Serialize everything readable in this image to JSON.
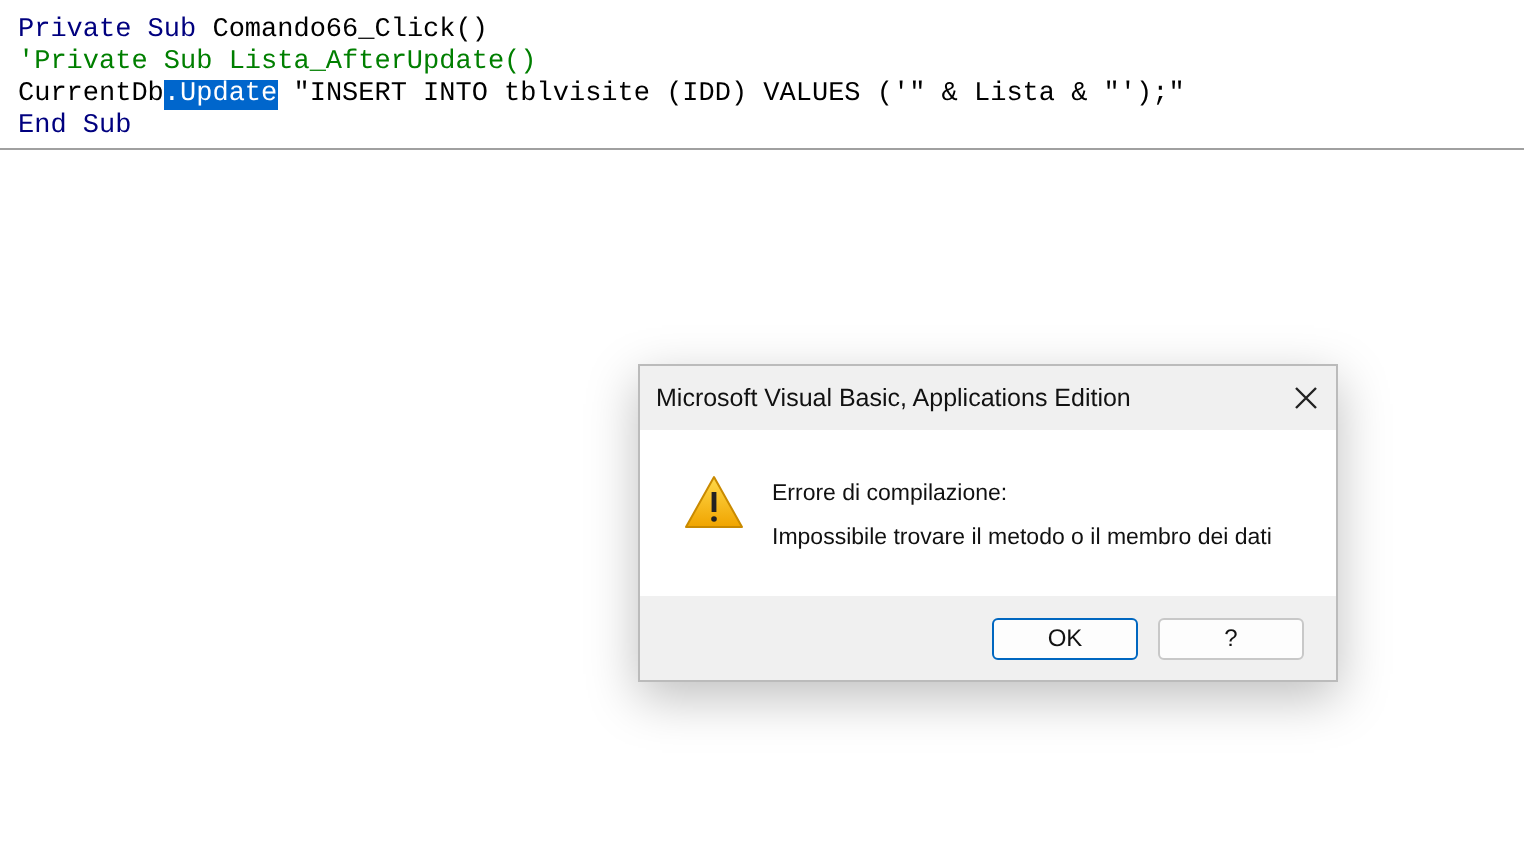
{
  "code": {
    "lines": [
      {
        "tokens": [
          {
            "text": "Private Sub",
            "kind": "keyword"
          },
          {
            "text": " Comando66_Click()",
            "kind": "text"
          }
        ]
      },
      {
        "tokens": [
          {
            "text": "'Private Sub Lista_AfterUpdate()",
            "kind": "comment"
          }
        ]
      },
      {
        "tokens": [
          {
            "text": "CurrentDb",
            "kind": "text"
          },
          {
            "text": ".Update",
            "kind": "selected"
          },
          {
            "text": " \"INSERT INTO tblvisite (IDD) VALUES ('\" & Lista & \"');\"",
            "kind": "text"
          }
        ]
      },
      {
        "tokens": [
          {
            "text": "End Sub",
            "kind": "keyword"
          }
        ]
      }
    ]
  },
  "dialog": {
    "title": "Microsoft Visual Basic, Applications Edition",
    "heading": "Errore di compilazione:",
    "message": "Impossibile trovare il metodo o il membro dei dati",
    "buttons": [
      {
        "label": "OK",
        "default": true
      },
      {
        "label": "?",
        "default": false
      }
    ]
  }
}
